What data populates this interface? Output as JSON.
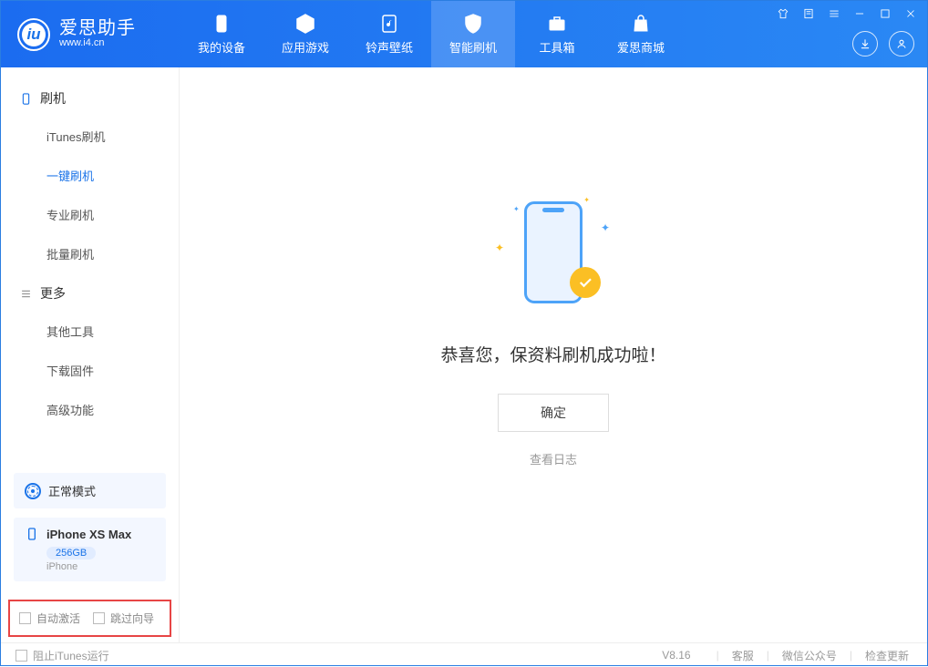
{
  "logo": {
    "cn": "爱思助手",
    "en": "www.i4.cn",
    "badge": "iu"
  },
  "nav": {
    "device": "我的设备",
    "apps": "应用游戏",
    "ringtone": "铃声壁纸",
    "flash": "智能刷机",
    "tools": "工具箱",
    "store": "爱思商城"
  },
  "sidebar": {
    "group_flash": "刷机",
    "items_flash": {
      "itunes": "iTunes刷机",
      "oneclick": "一键刷机",
      "pro": "专业刷机",
      "batch": "批量刷机"
    },
    "group_more": "更多",
    "items_more": {
      "other": "其他工具",
      "firmware": "下载固件",
      "advanced": "高级功能"
    }
  },
  "device": {
    "mode": "正常模式",
    "name": "iPhone XS Max",
    "capacity": "256GB",
    "type": "iPhone"
  },
  "checks": {
    "auto_activate": "自动激活",
    "skip_wizard": "跳过向导"
  },
  "main": {
    "message": "恭喜您，保资料刷机成功啦！",
    "ok": "确定",
    "view_log": "查看日志"
  },
  "footer": {
    "block_itunes": "阻止iTunes运行",
    "version": "V8.16",
    "support": "客服",
    "wechat": "微信公众号",
    "update": "检查更新"
  }
}
